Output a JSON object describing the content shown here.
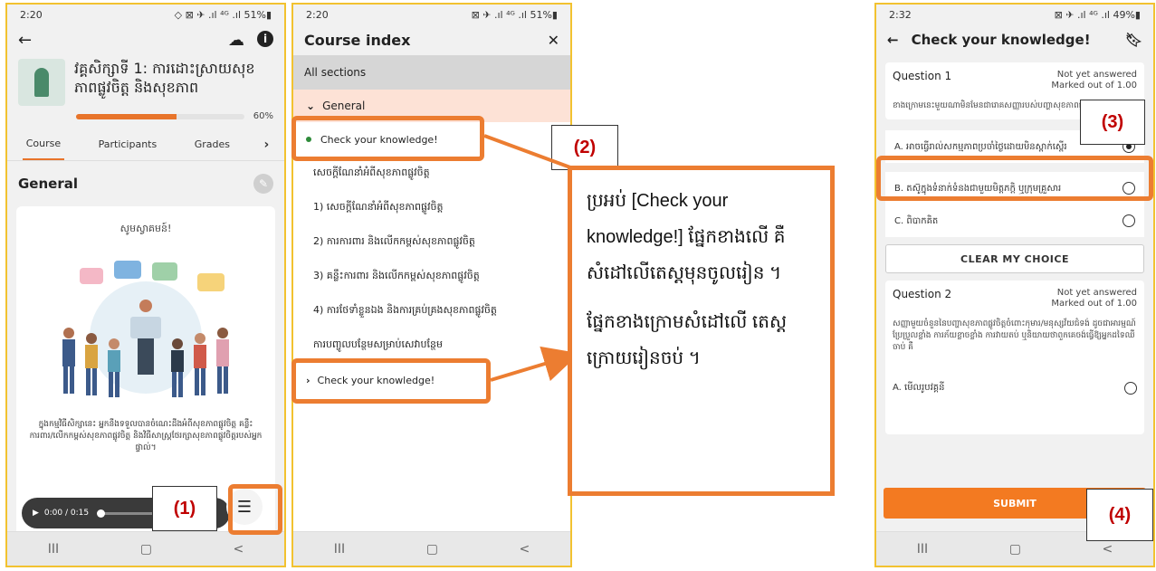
{
  "phone1": {
    "status": {
      "time": "2:20",
      "icons": "◇ ⊠ ✈ .ıl ⁴ᴳ .ıl 51%▮"
    },
    "course_title": "វគ្គសិក្សាទី 1: ការដោះស្រាយសុខភាពផ្លូវចិត្ត និងសុខភាព",
    "progress": 0.6,
    "progress_label": "60%",
    "tabs": [
      "Course",
      "Participants",
      "Grades"
    ],
    "section": "General",
    "greeting": "សូមស្វាគមន៍!",
    "card_text": "ក្នុងកម្មវិធីសិក្សានេះ អ្នកនឹងទទួលបានចំណេះដឹងអំពីសុខភាពផ្លូវចិត្ត គន្លឹះការពារ/លើកកម្ពស់សុខភាពផ្លូវចិត្ត និងវិធីសាស្ត្រថែរក្សាសុខភាពផ្លូវចិត្តរបស់អ្នកផ្ទាល់។",
    "audio_time": "0:00 / 0:15",
    "nav": [
      "III",
      "▢",
      "<"
    ]
  },
  "phone2": {
    "status": {
      "time": "2:20",
      "icons": "⊠ ✈ .ıl ⁴ᴳ .ıl 51%▮"
    },
    "title": "Course index",
    "all_sections": "All sections",
    "general": "General",
    "items": [
      "Check your knowledge!",
      "សេចក្តីណែនាំអំពីសុខភាពផ្លូវចិត្ត",
      "1) សេចក្តីណែនាំអំពីសុខភាពផ្លូវចិត្ត",
      "2) ការការពារ និងលើកកម្ពស់សុខភាពផ្លូវចិត្ត",
      "3) គន្លឹះការពារ និងលើកកម្ពស់សុខភាពផ្លូវចិត្ត",
      "4) ការថែទាំខ្លួនឯង និងការគ្រប់គ្រងសុខភាពផ្លូវចិត្ត",
      "ការបញ្ចូលបន្ថែមសម្រាប់សេវាបន្ថែម",
      "Check your knowledge!"
    ],
    "nav": [
      "III",
      "▢",
      "<"
    ]
  },
  "phone3": {
    "status": {
      "time": "2:32",
      "icons": "⊠ ✈ .ıl ⁴ᴳ .ıl 49%▮"
    },
    "title": "Check your knowledge!",
    "q1": {
      "label": "Question 1",
      "status1": "Not yet answered",
      "status2": "Marked out of 1.00",
      "text": "ខាងក្រោមនេះមួយណាមិនមែនជារោគសញ្ញារបស់បញ្ហាសុខភាពផ្លូវចិត្ត?",
      "options": [
        {
          "letter": "A.",
          "text": "អាចធ្វើរាល់សកម្មភាពប្រចាំថ្ងៃដោយមិនស្ពាក់ស្ពើរ"
        },
        {
          "letter": "B.",
          "text": "តស៊ូក្នុងទំនាក់ទំនងជាមួយមិត្តភក្តិ ឬក្រុមគ្រួសារ"
        },
        {
          "letter": "C.",
          "text": "ពិបាកគិត"
        }
      ],
      "clear": "CLEAR MY CHOICE"
    },
    "q2": {
      "label": "Question 2",
      "status1": "Not yet answered",
      "status2": "Marked out of 1.00",
      "text": "សញ្ញាមួយចំនួននៃបញ្ហាសុខភាពផ្លូវចិត្តចំពោះកុមារ/មនុស្សវ័យជំទង់ ដូចជាអារម្មណ៍ប្រែប្រួលខ្លាំង ការភ័យខ្លាចខ្លាំង ការវាយតប់ ឬនិយាយថាពួកគេចង់ធ្វើឱ្យអ្នកដទៃឈឺចាប់ គឺ",
      "option_a": {
        "letter": "A.",
        "text": "មើលរូបវគ្គនី"
      }
    },
    "submit": "SUBMIT",
    "nav": [
      "III",
      "▢",
      "<"
    ]
  },
  "annotations": {
    "label1": "(1)",
    "label2": "(2)",
    "label3": "(3)",
    "label4": "(4)",
    "callout_p1": "ប្រអប់ [Check your knowledge!] ផ្នែកខាងលើ គឺសំដៅលើតេស្តមុនចូលរៀន ។",
    "callout_p2": "ផ្នែកខាងក្រោមសំដៅលើ តេស្តក្រោយរៀនចប់ ។"
  }
}
